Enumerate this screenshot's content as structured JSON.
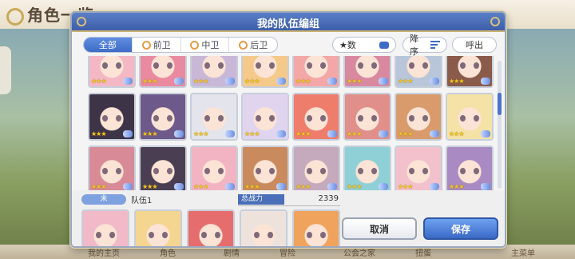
{
  "background": {
    "title": "角色一览",
    "bottom_tabs": [
      "我的主页",
      "角色",
      "剧情",
      "冒险",
      "公会之家",
      "扭蛋",
      "主菜单"
    ]
  },
  "dialog": {
    "title": "我的队伍编组",
    "tabs": [
      {
        "label": "全部",
        "active": true
      },
      {
        "label": "前卫",
        "active": false
      },
      {
        "label": "中卫",
        "active": false
      },
      {
        "label": "后卫",
        "active": false
      }
    ],
    "sort_key": "★数",
    "sort_order": "降序",
    "call_button": "呼出"
  },
  "characters": [
    {
      "stars": "★★★",
      "color": "#f4b7c4"
    },
    {
      "stars": "★★★",
      "color": "#e98aa0"
    },
    {
      "stars": "★★★",
      "color": "#c9b7d8"
    },
    {
      "stars": "★★★",
      "color": "#f5c98a"
    },
    {
      "stars": "★★★",
      "color": "#f3a7a7"
    },
    {
      "stars": "★★★",
      "color": "#d889a0"
    },
    {
      "stars": "★★★",
      "color": "#b9c6d9"
    },
    {
      "stars": "★★★",
      "color": "#8a5a4a"
    },
    {
      "stars": "★★★",
      "color": "#3e3448"
    },
    {
      "stars": "★★★",
      "color": "#6e5a8a"
    },
    {
      "stars": "★★★",
      "color": "#e4e4ec"
    },
    {
      "stars": "★★★",
      "color": "#e1d4ee"
    },
    {
      "stars": "★★★",
      "color": "#ef7d6b"
    },
    {
      "stars": "★★★",
      "color": "#e08f8a"
    },
    {
      "stars": "★★★",
      "color": "#d99a6c"
    },
    {
      "stars": "★★★",
      "color": "#f4e2a6"
    },
    {
      "stars": "★★★",
      "color": "#d88a96"
    },
    {
      "stars": "★★★",
      "color": "#4a3f52"
    },
    {
      "stars": "★★★",
      "color": "#f2b3c2"
    },
    {
      "stars": "★★★",
      "color": "#c98a5e"
    },
    {
      "stars": "★★★",
      "color": "#c5a9bd"
    },
    {
      "stars": "★★★",
      "color": "#8fd0d6"
    },
    {
      "stars": "★★★",
      "color": "#f2c1cc"
    },
    {
      "stars": "★★★",
      "color": "#a98ac2"
    }
  ],
  "team": {
    "tag": "未",
    "name": "队伍1",
    "power_label": "总战力",
    "power_value": "2339",
    "members": [
      {
        "stars": "★★★★★",
        "color": "#f2b9c8"
      },
      {
        "stars": "★★★",
        "color": "#f4d690"
      },
      {
        "stars": "★★★",
        "color": "#e66d6d"
      },
      {
        "stars": "★★★",
        "color": "#eee2dc"
      },
      {
        "stars": "★★★",
        "color": "#f0a35c"
      }
    ]
  },
  "buttons": {
    "cancel": "取消",
    "save": "保存"
  }
}
